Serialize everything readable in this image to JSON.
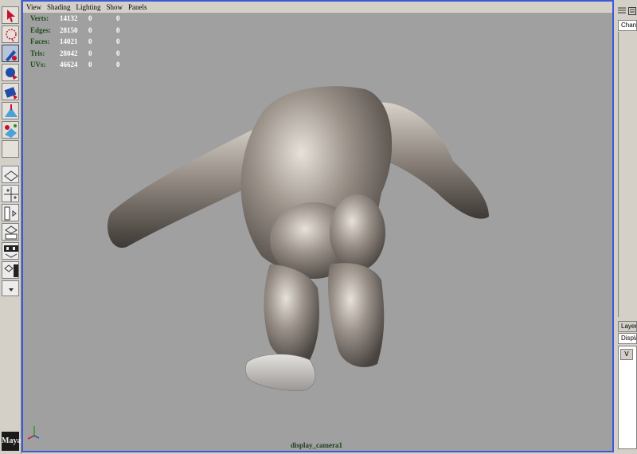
{
  "menu": [
    "View",
    "Shading",
    "Lighting",
    "Show",
    "Panels"
  ],
  "hud": {
    "rows": [
      {
        "label": "Verts:",
        "values": [
          "14132",
          "0",
          "0"
        ]
      },
      {
        "label": "Edges:",
        "values": [
          "28150",
          "0",
          "0"
        ]
      },
      {
        "label": "Faces:",
        "values": [
          "14021",
          "0",
          "0"
        ]
      },
      {
        "label": "Tris:",
        "values": [
          "28042",
          "0",
          "0"
        ]
      },
      {
        "label": "UVs:",
        "values": [
          "46624",
          "0",
          "0"
        ]
      }
    ]
  },
  "camera_name": "display_camera1",
  "right_panel": {
    "channel_tab": "Chann",
    "layer_tab": "Layer",
    "display_tab": "Displa",
    "v_label": "V"
  },
  "logo_text": "Maya",
  "colors": {
    "viewport_bg": "#a0a0a0",
    "viewport_border": "#3b5bd6",
    "hud_label": "#1d4d1d",
    "hud_value": "#ffffff"
  }
}
